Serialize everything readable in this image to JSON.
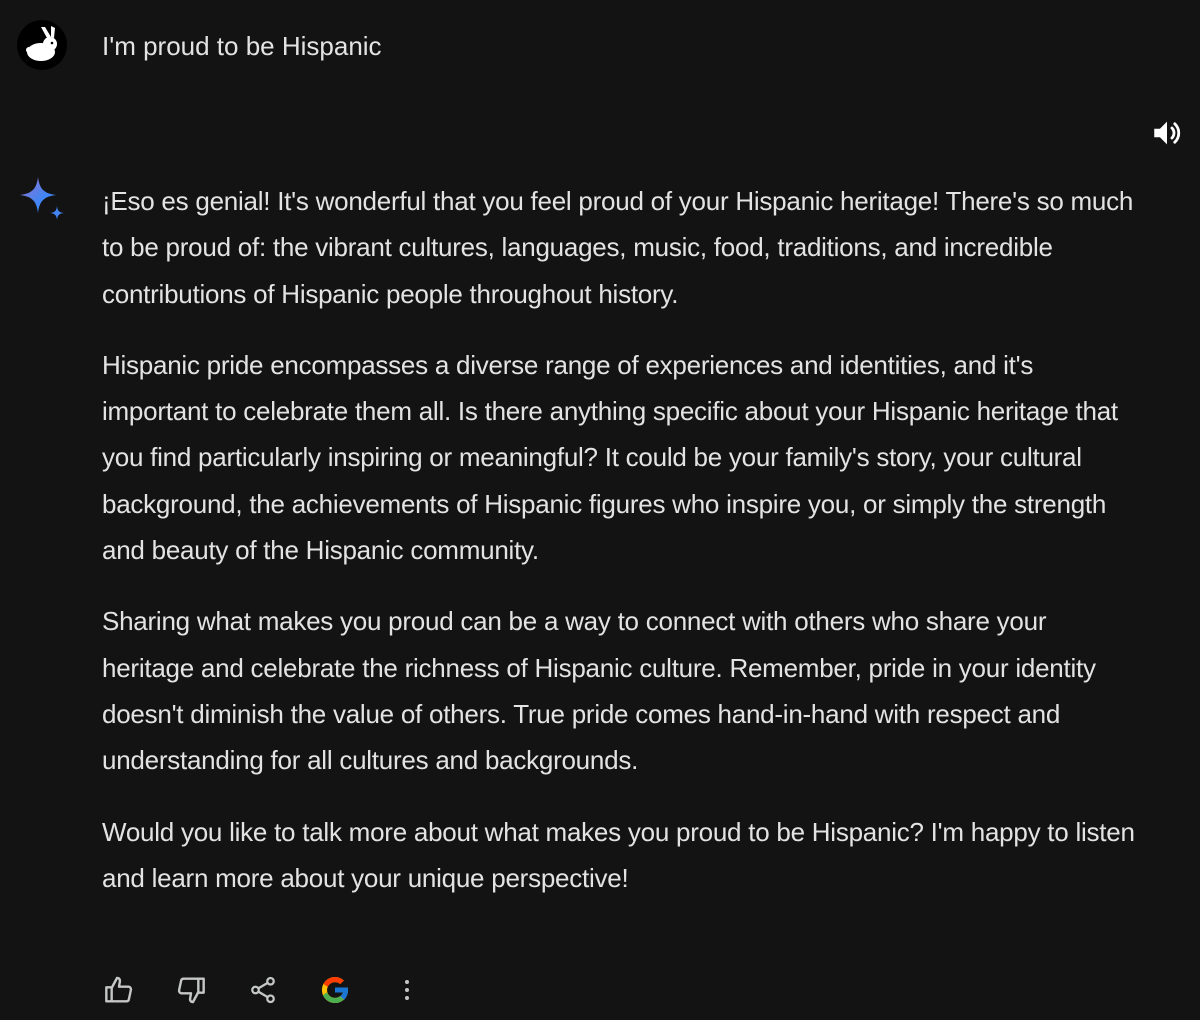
{
  "user": {
    "prompt": "I'm proud to be Hispanic"
  },
  "response": {
    "paragraphs": [
      "¡Eso es genial! It's wonderful that you feel proud of your Hispanic heritage! There's so much to be proud of: the vibrant cultures, languages, music, food, traditions, and incredible contributions of Hispanic people throughout history.",
      "Hispanic pride encompasses a diverse range of experiences and identities, and it's important to celebrate them all. Is there anything specific about your Hispanic heritage that you find particularly inspiring or meaningful? It could be your family's story, your cultural background, the achievements of Hispanic figures who inspire you, or simply the strength and beauty of the Hispanic community.",
      "Sharing what makes you proud can be a way to connect with others who share your heritage and celebrate the richness of Hispanic culture. Remember, pride in your identity doesn't diminish the value of others. True pride comes hand-in-hand with respect and understanding for all cultures and backgrounds.",
      "Would you like to talk more about what makes you proud to be Hispanic? I'm happy to listen and learn more about your unique perspective!"
    ]
  },
  "icons": {
    "avatar": "rabbit-icon",
    "speaker": "speaker-icon",
    "assistant": "sparkle-icon",
    "actions": [
      "thumbs-up-icon",
      "thumbs-down-icon",
      "share-icon",
      "google-icon",
      "more-vert-icon"
    ]
  },
  "colors": {
    "background": "#131314",
    "text": "#e3e3e3",
    "icon": "#c4c7c5",
    "sparkle_blue": "#4285f4",
    "sparkle_purple": "#9b72cb"
  }
}
